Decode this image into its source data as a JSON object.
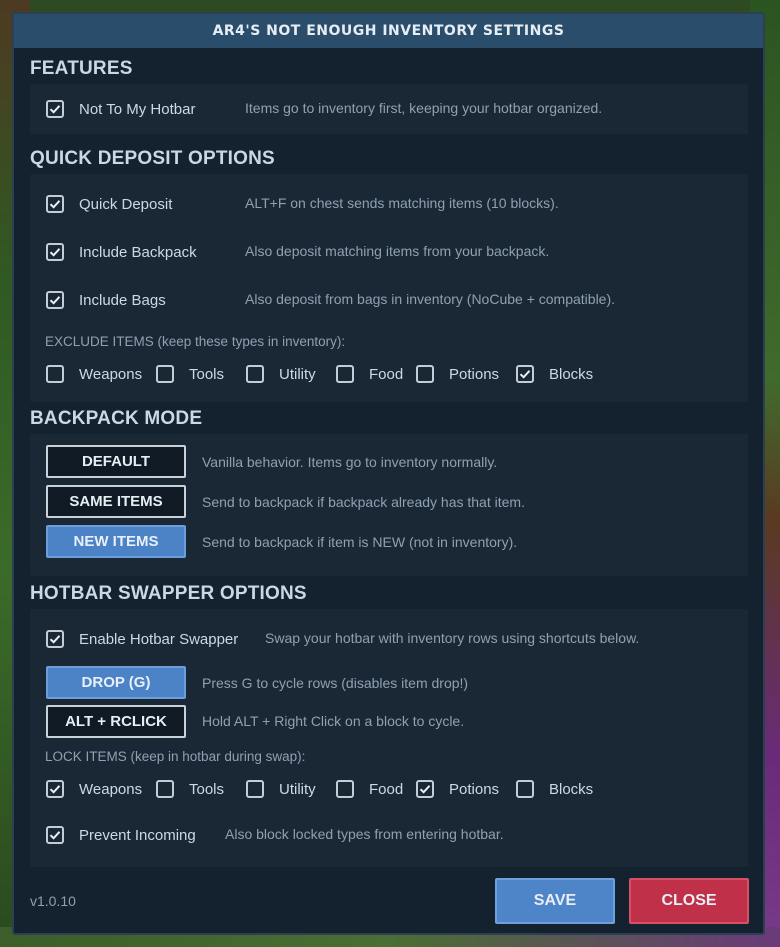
{
  "title": "AR4'S NOT ENOUGH INVENTORY SETTINGS",
  "features": {
    "heading": "FEATURES",
    "not_to_hotbar": {
      "label": "Not To My Hotbar",
      "desc": "Items go to inventory first, keeping your hotbar organized.",
      "checked": true
    }
  },
  "quick_deposit": {
    "heading": "QUICK DEPOSIT OPTIONS",
    "options": [
      {
        "label": "Quick Deposit",
        "desc": "ALT+F on chest sends matching items (10 blocks).",
        "checked": true
      },
      {
        "label": "Include Backpack",
        "desc": "Also deposit matching items from your backpack.",
        "checked": true
      },
      {
        "label": "Include Bags",
        "desc": "Also deposit from bags in inventory (NoCube + compatible).",
        "checked": true
      }
    ],
    "exclude_label": "EXCLUDE ITEMS (keep these types in inventory):",
    "exclude": [
      {
        "label": "Weapons",
        "checked": false
      },
      {
        "label": "Tools",
        "checked": false
      },
      {
        "label": "Utility",
        "checked": false
      },
      {
        "label": "Food",
        "checked": false
      },
      {
        "label": "Potions",
        "checked": false
      },
      {
        "label": "Blocks",
        "checked": true
      }
    ]
  },
  "backpack_mode": {
    "heading": "BACKPACK MODE",
    "modes": [
      {
        "label": "DEFAULT",
        "desc": "Vanilla behavior. Items go to inventory normally.",
        "selected": false
      },
      {
        "label": "SAME ITEMS",
        "desc": "Send to backpack if backpack already has that item.",
        "selected": false
      },
      {
        "label": "NEW ITEMS",
        "desc": "Send to backpack if item is NEW (not in inventory).",
        "selected": true
      }
    ]
  },
  "hotbar_swapper": {
    "heading": "HOTBAR SWAPPER OPTIONS",
    "enable": {
      "label": "Enable Hotbar Swapper",
      "desc": "Swap your hotbar with inventory rows using shortcuts below.",
      "checked": true
    },
    "keys": [
      {
        "label": "DROP (G)",
        "desc": "Press G to cycle rows (disables item drop!)",
        "active": true
      },
      {
        "label": "ALT + RCLICK",
        "desc": "Hold ALT + Right Click on a block to cycle.",
        "active": false
      }
    ],
    "lock_label": "LOCK ITEMS (keep in hotbar during swap):",
    "lock": [
      {
        "label": "Weapons",
        "checked": true
      },
      {
        "label": "Tools",
        "checked": false
      },
      {
        "label": "Utility",
        "checked": false
      },
      {
        "label": "Food",
        "checked": false
      },
      {
        "label": "Potions",
        "checked": true
      },
      {
        "label": "Blocks",
        "checked": false
      }
    ],
    "prevent": {
      "label": "Prevent Incoming",
      "desc": "Also block locked types from entering hotbar.",
      "checked": true
    }
  },
  "footer": {
    "version": "v1.0.10",
    "save_label": "SAVE",
    "close_label": "CLOSE"
  },
  "colors": {
    "panel_bg": "#14212e",
    "title_bar": "#2b4d6c",
    "accent_blue": "#4c82c6",
    "close_red": "#c03048"
  }
}
